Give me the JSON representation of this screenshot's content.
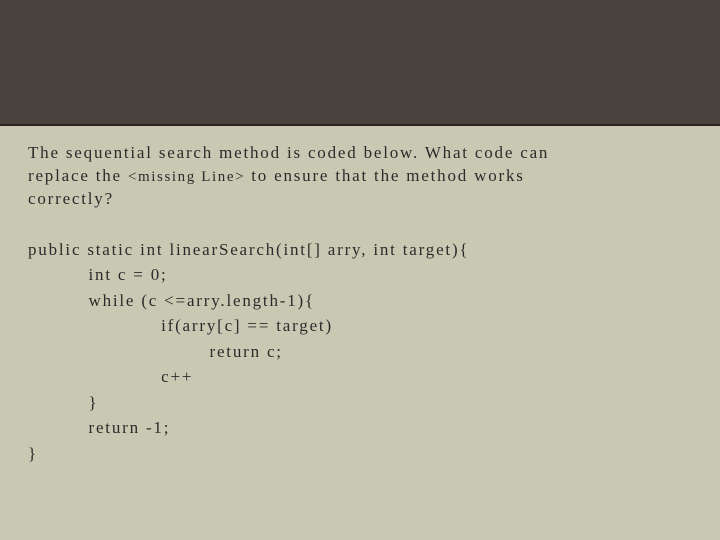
{
  "question": {
    "line1": "The sequential search method is coded below. What code can",
    "line2_pre": "replace the ",
    "line2_missing": "<missing Line>",
    "line2_post": " to ensure that the method works",
    "line3": "correctly?"
  },
  "code": {
    "l1": "public static int linearSearch(int[] arry, int target){",
    "l2": "          int c = 0;",
    "l3": "          while (c <=arry.length-1){",
    "l4": "                      if(arry[c] == target)",
    "l5": "                              return c;",
    "l6": "                      c++",
    "l7": "          }",
    "l8": "          return -1;",
    "l9": "}"
  }
}
